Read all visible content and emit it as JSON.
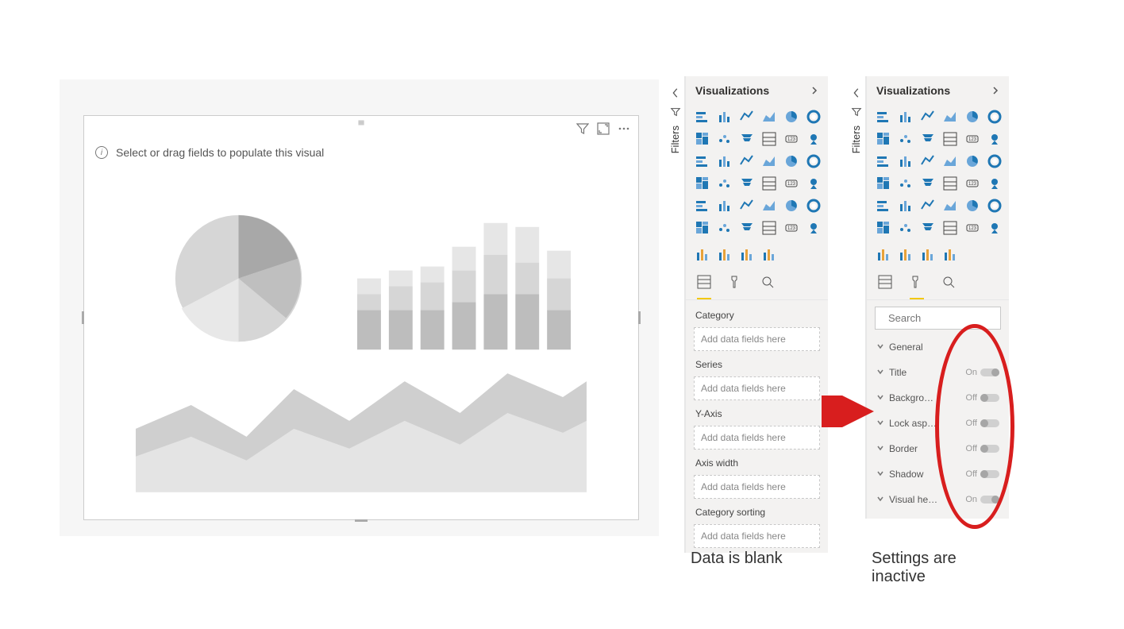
{
  "canvas": {
    "hint": "Select or drag fields to populate this visual"
  },
  "filters_label": "Filters",
  "panel_title": "Visualizations",
  "visual_types": [
    "stacked-bar",
    "stacked-column",
    "clustered-bar",
    "clustered-column",
    "100-stacked-bar",
    "100-stacked-column",
    "line",
    "area",
    "stacked-area",
    "line-stacked-column",
    "line-clustered-column",
    "ribbon",
    "waterfall",
    "funnel",
    "scatter",
    "pie",
    "donut",
    "treemap",
    "map",
    "filled-map",
    "shape-map",
    "gauge",
    "card",
    "multi-row-card",
    "kpi",
    "slicer",
    "table",
    "matrix",
    "r-visual",
    "python-visual",
    "key-influencers",
    "decomposition-tree",
    "qa",
    "paginated",
    "power-apps",
    "more"
  ],
  "custom_visuals": [
    "custom-1",
    "custom-2",
    "custom-3",
    "custom-4"
  ],
  "fields_tab": {
    "wells": [
      {
        "label": "Category",
        "placeholder": "Add data fields here"
      },
      {
        "label": "Series",
        "placeholder": "Add data fields here"
      },
      {
        "label": "Y-Axis",
        "placeholder": "Add data fields here"
      },
      {
        "label": "Axis width",
        "placeholder": "Add data fields here"
      },
      {
        "label": "Category sorting",
        "placeholder": "Add data fields here"
      }
    ]
  },
  "format_tab": {
    "search_placeholder": "Search",
    "rows": [
      {
        "label": "General",
        "state": null
      },
      {
        "label": "Title",
        "state": "On"
      },
      {
        "label": "Backgro…",
        "state": "Off"
      },
      {
        "label": "Lock asp…",
        "state": "Off"
      },
      {
        "label": "Border",
        "state": "Off"
      },
      {
        "label": "Shadow",
        "state": "Off"
      },
      {
        "label": "Visual he…",
        "state": "On"
      }
    ]
  },
  "captions": {
    "left": "Data is blank",
    "right": "Settings are inactive"
  }
}
